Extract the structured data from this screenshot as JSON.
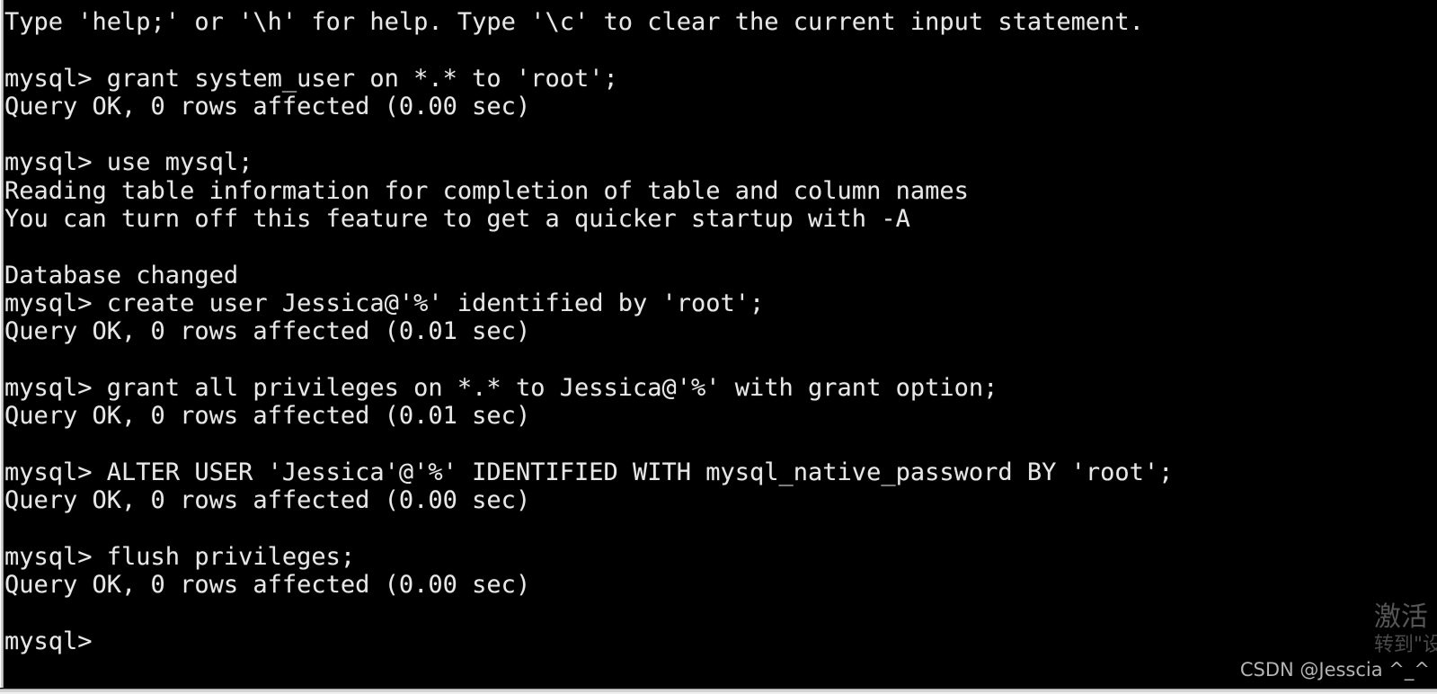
{
  "window": {
    "type": "terminal",
    "shell": "mysql-client",
    "background_color": "#000000",
    "foreground_color": "#e8e8e8",
    "frame_color": "#d4d4d4"
  },
  "console": {
    "prompt": "mysql>",
    "lines": [
      "Type 'help;' or '\\h' for help. Type '\\c' to clear the current input statement.",
      "",
      "mysql> grant system_user on *.* to 'root';",
      "Query OK, 0 rows affected (0.00 sec)",
      "",
      "mysql> use mysql;",
      "Reading table information for completion of table and column names",
      "You can turn off this feature to get a quicker startup with -A",
      "",
      "Database changed",
      "mysql> create user Jessica@'%' identified by 'root';",
      "Query OK, 0 rows affected (0.01 sec)",
      "",
      "mysql> grant all privileges on *.* to Jessica@'%' with grant option;",
      "Query OK, 0 rows affected (0.01 sec)",
      "",
      "mysql> ALTER USER 'Jessica'@'%' IDENTIFIED WITH mysql_native_password BY 'root';",
      "Query OK, 0 rows affected (0.00 sec)",
      "",
      "mysql> flush privileges;",
      "Query OK, 0 rows affected (0.00 sec)",
      "",
      "mysql>"
    ]
  },
  "watermarks": {
    "activation_title": "激活",
    "activation_subtitle": "转到\"设",
    "csdn_credit": "CSDN @Jesscia ^_^"
  }
}
